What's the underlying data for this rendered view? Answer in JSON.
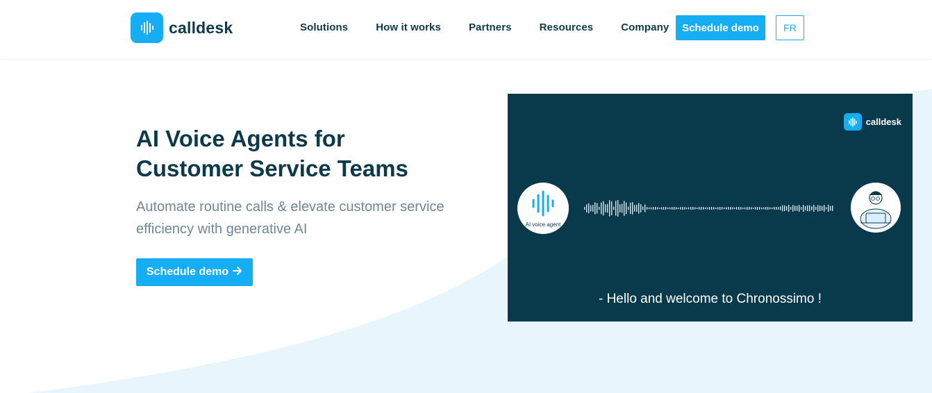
{
  "brand": {
    "name": "calldesk",
    "accent": "#15aef5",
    "dark": "#0c3a4a"
  },
  "nav": {
    "items": [
      "Solutions",
      "How it works",
      "Partners",
      "Resources",
      "Company"
    ],
    "demo_label": "Schedule demo",
    "lang_label": "FR"
  },
  "hero": {
    "title_line1": "AI Voice Agents for",
    "title_line2": "Customer Service Teams",
    "subtitle_line1": "Automate routine calls & elevate customer service",
    "subtitle_line2": "efficiency with generative AI",
    "cta_label": "Schedule demo",
    "cta_icon": "arrow-right-icon"
  },
  "video": {
    "logo_text": "calldesk",
    "agent_label": "AI voice agent",
    "caption": "- Hello and welcome to Chronossimo !",
    "background": "#083a4b"
  }
}
